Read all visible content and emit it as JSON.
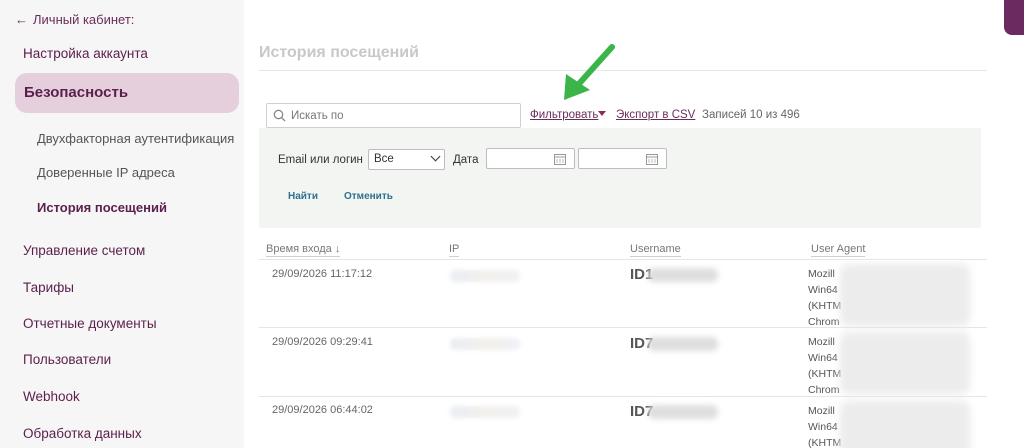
{
  "sidebar": {
    "back_label": "Личный кабинет:",
    "items": [
      {
        "label": "Настройка аккаунта"
      },
      {
        "label": "Безопасность",
        "active": true
      },
      {
        "label": "Управление счетом"
      },
      {
        "label": "Тарифы"
      },
      {
        "label": "Отчетные документы"
      },
      {
        "label": "Пользователи"
      },
      {
        "label": "Webhook"
      },
      {
        "label": "Обработка данных"
      }
    ],
    "subitems": [
      {
        "label": "Двухфакторная аутентификация"
      },
      {
        "label": "Доверенные IP адреса"
      },
      {
        "label": "История посещений",
        "active": true
      }
    ]
  },
  "main": {
    "title": "История посещений",
    "search": {
      "placeholder": "Искать по",
      "value": ""
    },
    "filter_label": "Фильтровать",
    "export_label": "Экспорт в CSV",
    "records_text": "Записей 10 из 496",
    "filters": {
      "login_label": "Email или логин",
      "login_select_value": "Все",
      "date_label": "Дата",
      "find_label": "Найти",
      "cancel_label": "Отменить"
    },
    "table": {
      "columns": [
        "Время входа ↓",
        "IP",
        "Username",
        "User Agent"
      ],
      "rows": [
        {
          "time": "29/09/2026 11:17:12",
          "id_prefix": "ID1",
          "ua_lines": [
            "Mozill",
            "Win64",
            "(KHTM",
            "Chrom"
          ]
        },
        {
          "time": "29/09/2026 09:29:41",
          "id_prefix": "ID7",
          "ua_lines": [
            "Mozill",
            "Win64",
            "(KHTM",
            "Chrom"
          ]
        },
        {
          "time": "29/09/2026 06:44:02",
          "id_prefix": "ID7",
          "ua_lines": [
            "Mozill",
            "Win64",
            "(KHTM"
          ]
        }
      ]
    }
  },
  "colors": {
    "accent": "#5a1f4c",
    "active_bg": "#e6cfdd",
    "annotation_arrow": "#3bb54a"
  }
}
